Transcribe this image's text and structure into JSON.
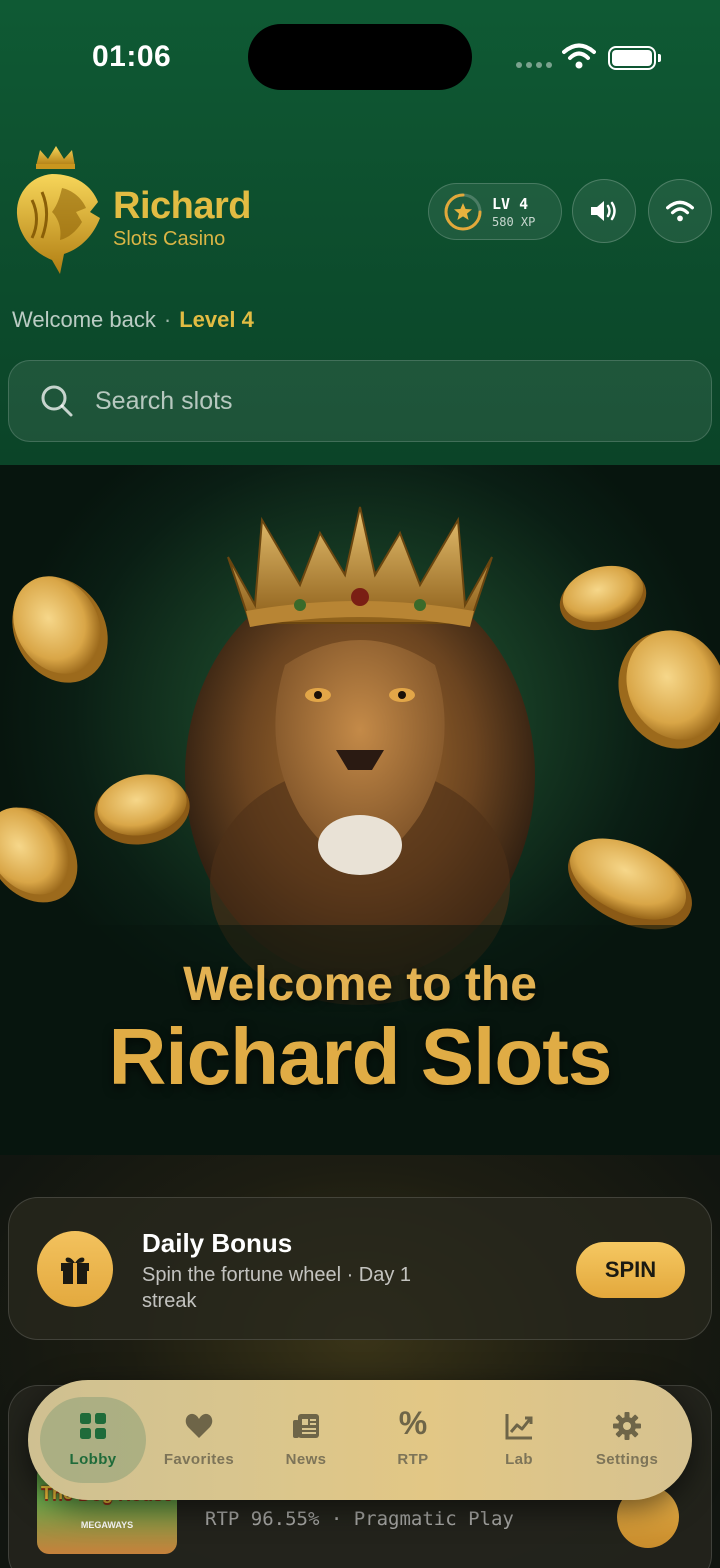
{
  "status_bar": {
    "time": "01:06"
  },
  "brand": {
    "name": "Richard",
    "subtitle": "Slots Casino"
  },
  "level_badge": {
    "level_label": "LV 4",
    "xp_label": "580 XP"
  },
  "welcome": {
    "text": "Welcome back",
    "separator": "·",
    "level": "Level 4"
  },
  "search": {
    "placeholder": "Search slots",
    "value": ""
  },
  "hero": {
    "line1": "Welcome to the",
    "line2": "Richard Slots"
  },
  "daily_bonus": {
    "title": "Daily Bonus",
    "description": "Spin the fortune wheel · Day 1 streak",
    "button_label": "SPIN"
  },
  "game_card": {
    "thumbnail_title": "The Dog House",
    "thumbnail_subtitle": "MEGAWAYS",
    "meta": "RTP 96.55% · Pragmatic Play"
  },
  "tabbar": {
    "items": [
      {
        "label": "Lobby",
        "icon": "grid-icon",
        "active": true
      },
      {
        "label": "Favorites",
        "icon": "heart-icon",
        "active": false
      },
      {
        "label": "News",
        "icon": "newspaper-icon",
        "active": false
      },
      {
        "label": "RTP",
        "icon": "percent-icon",
        "active": false
      },
      {
        "label": "Lab",
        "icon": "chart-line-icon",
        "active": false
      },
      {
        "label": "Settings",
        "icon": "gear-icon",
        "active": false
      }
    ],
    "rtp_symbol": "%"
  },
  "colors": {
    "header_green": "#0f5a34",
    "gold_accent": "#e2bc43",
    "active_tab_text": "#1f6b3a"
  }
}
